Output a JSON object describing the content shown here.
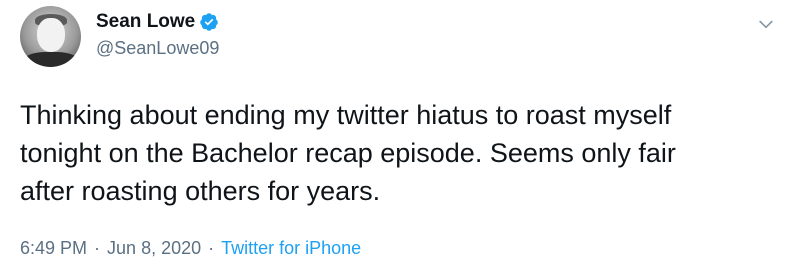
{
  "author": {
    "display_name": "Sean Lowe",
    "handle": "@SeanLowe09",
    "verified": true
  },
  "tweet": {
    "text": "Thinking about ending my twitter hiatus to roast myself\ntonight on the Bachelor recap episode. Seems only fair\nafter roasting others for years."
  },
  "meta": {
    "time": "6:49 PM",
    "separator": "·",
    "date": "Jun 8, 2020",
    "source": "Twitter for iPhone"
  },
  "icons": {
    "verified": "verified-badge-icon",
    "menu": "chevron-down-icon"
  },
  "colors": {
    "accent": "#1da1f2",
    "secondary_text": "#5b7083",
    "primary_text": "#0f1419"
  }
}
